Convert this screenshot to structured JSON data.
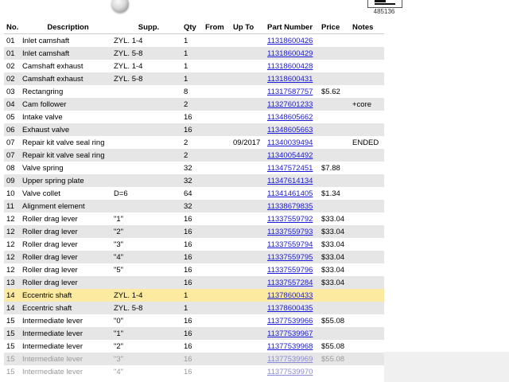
{
  "diagram_id": "485136",
  "columns": [
    "No.",
    "Description",
    "Supp.",
    "Qty",
    "From",
    "Up To",
    "Part Number",
    "Price",
    "Notes"
  ],
  "rows": [
    {
      "no": "01",
      "desc": "Inlet camshaft",
      "supp": "ZYL. 1-4",
      "qty": "1",
      "from": "",
      "upto": "",
      "pn": "11318600426",
      "price": "",
      "notes": ""
    },
    {
      "no": "01",
      "desc": "Inlet camshaft",
      "supp": "ZYL. 5-8",
      "qty": "1",
      "from": "",
      "upto": "",
      "pn": "11318600429",
      "price": "",
      "notes": ""
    },
    {
      "no": "02",
      "desc": "Camshaft exhaust",
      "supp": "ZYL. 1-4",
      "qty": "1",
      "from": "",
      "upto": "",
      "pn": "11318600428",
      "price": "",
      "notes": ""
    },
    {
      "no": "02",
      "desc": "Camshaft exhaust",
      "supp": "ZYL. 5-8",
      "qty": "1",
      "from": "",
      "upto": "",
      "pn": "11318600431",
      "price": "",
      "notes": ""
    },
    {
      "no": "03",
      "desc": "Rectangring",
      "supp": "",
      "qty": "8",
      "from": "",
      "upto": "",
      "pn": "11317587757",
      "price": "$5.62",
      "notes": ""
    },
    {
      "no": "04",
      "desc": "Cam follower",
      "supp": "",
      "qty": "2",
      "from": "",
      "upto": "",
      "pn": "11327601233",
      "price": "",
      "notes": "+core"
    },
    {
      "no": "05",
      "desc": "Intake valve",
      "supp": "",
      "qty": "16",
      "from": "",
      "upto": "",
      "pn": "11348605662",
      "price": "",
      "notes": ""
    },
    {
      "no": "06",
      "desc": "Exhaust valve",
      "supp": "",
      "qty": "16",
      "from": "",
      "upto": "",
      "pn": "11348605663",
      "price": "",
      "notes": ""
    },
    {
      "no": "07",
      "desc": "Repair kit valve seal ring",
      "supp": "",
      "qty": "2",
      "from": "",
      "upto": "09/2017",
      "pn": "11340039494",
      "price": "",
      "notes": "ENDED"
    },
    {
      "no": "07",
      "desc": "Repair kit valve seal ring",
      "supp": "",
      "qty": "2",
      "from": "",
      "upto": "",
      "pn": "11340054492",
      "price": "",
      "notes": ""
    },
    {
      "no": "08",
      "desc": "Valve spring",
      "supp": "",
      "qty": "32",
      "from": "",
      "upto": "",
      "pn": "11347572451",
      "price": "$7.88",
      "notes": ""
    },
    {
      "no": "09",
      "desc": "Upper spring plate",
      "supp": "",
      "qty": "32",
      "from": "",
      "upto": "",
      "pn": "11347614134",
      "price": "",
      "notes": ""
    },
    {
      "no": "10",
      "desc": "Valve collet",
      "supp": "D=6",
      "qty": "64",
      "from": "",
      "upto": "",
      "pn": "11341461405",
      "price": "$1.34",
      "notes": ""
    },
    {
      "no": "11",
      "desc": "Alignment element",
      "supp": "",
      "qty": "32",
      "from": "",
      "upto": "",
      "pn": "11338679835",
      "price": "",
      "notes": ""
    },
    {
      "no": "12",
      "desc": "Roller drag lever",
      "supp": "\"1\"",
      "qty": "16",
      "from": "",
      "upto": "",
      "pn": "11337559792",
      "price": "$33.04",
      "notes": ""
    },
    {
      "no": "12",
      "desc": "Roller drag lever",
      "supp": "\"2\"",
      "qty": "16",
      "from": "",
      "upto": "",
      "pn": "11337559793",
      "price": "$33.04",
      "notes": ""
    },
    {
      "no": "12",
      "desc": "Roller drag lever",
      "supp": "\"3\"",
      "qty": "16",
      "from": "",
      "upto": "",
      "pn": "11337559794",
      "price": "$33.04",
      "notes": ""
    },
    {
      "no": "12",
      "desc": "Roller drag lever",
      "supp": "\"4\"",
      "qty": "16",
      "from": "",
      "upto": "",
      "pn": "11337559795",
      "price": "$33.04",
      "notes": ""
    },
    {
      "no": "12",
      "desc": "Roller drag lever",
      "supp": "\"5\"",
      "qty": "16",
      "from": "",
      "upto": "",
      "pn": "11337559796",
      "price": "$33.04",
      "notes": ""
    },
    {
      "no": "13",
      "desc": "Roller drag lever",
      "supp": "",
      "qty": "16",
      "from": "",
      "upto": "",
      "pn": "11337557284",
      "price": "$33.04",
      "notes": ""
    },
    {
      "no": "14",
      "desc": "Eccentric shaft",
      "supp": "ZYL. 1-4",
      "qty": "1",
      "from": "",
      "upto": "",
      "pn": "11378600433",
      "price": "",
      "notes": ""
    },
    {
      "no": "14",
      "desc": "Eccentric shaft",
      "supp": "ZYL. 5-8",
      "qty": "1",
      "from": "",
      "upto": "",
      "pn": "11378600435",
      "price": "",
      "notes": ""
    },
    {
      "no": "15",
      "desc": "Intermediate lever",
      "supp": "\"0\"",
      "qty": "16",
      "from": "",
      "upto": "",
      "pn": "11377539966",
      "price": "$55.08",
      "notes": ""
    },
    {
      "no": "15",
      "desc": "Intermediate lever",
      "supp": "\"1\"",
      "qty": "16",
      "from": "",
      "upto": "",
      "pn": "11377539967",
      "price": "",
      "notes": ""
    },
    {
      "no": "15",
      "desc": "Intermediate lever",
      "supp": "\"2\"",
      "qty": "16",
      "from": "",
      "upto": "",
      "pn": "11377539968",
      "price": "$55.08",
      "notes": ""
    },
    {
      "no": "15",
      "desc": "Intermediate lever",
      "supp": "\"3\"",
      "qty": "16",
      "from": "",
      "upto": "",
      "pn": "11377539969",
      "price": "$55.08",
      "notes": ""
    },
    {
      "no": "15",
      "desc": "Intermediate lever",
      "supp": "\"4\"",
      "qty": "16",
      "from": "",
      "upto": "",
      "pn": "11377539970",
      "price": "",
      "notes": ""
    }
  ],
  "highlighted_row": 20,
  "faded_rows": [
    25,
    26
  ],
  "colors": {
    "link": "#1a1ad6",
    "highlight": "#fbeaa0",
    "stripe": "#e6e6e6"
  },
  "icons": {
    "zoom_control": "zoom-knob-icon",
    "diagram_thumbnail": "diagram-thumbnail-icon"
  }
}
